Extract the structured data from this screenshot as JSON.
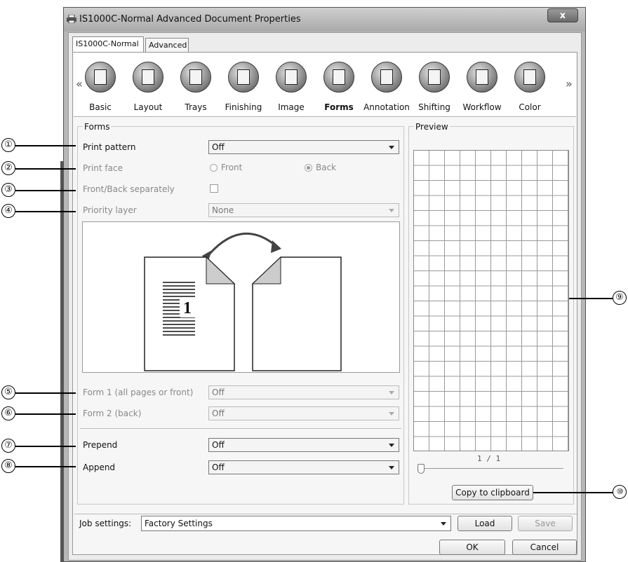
{
  "window": {
    "title": "IS1000C-Normal Advanced Document Properties",
    "close_label": "x"
  },
  "tabs": [
    {
      "label": "IS1000C-Normal"
    },
    {
      "label": "Advanced"
    }
  ],
  "iconbar": {
    "prev_arrow": "«",
    "next_arrow": "»",
    "items": [
      {
        "label": "Basic",
        "icon": "basic-icon"
      },
      {
        "label": "Layout",
        "icon": "layout-icon"
      },
      {
        "label": "Trays",
        "icon": "trays-icon"
      },
      {
        "label": "Finishing",
        "icon": "finishing-icon"
      },
      {
        "label": "Image",
        "icon": "image-icon"
      },
      {
        "label": "Forms",
        "icon": "forms-icon",
        "selected": true
      },
      {
        "label": "Annotation",
        "icon": "annotation-icon"
      },
      {
        "label": "Shifting",
        "icon": "shifting-icon"
      },
      {
        "label": "Workflow",
        "icon": "workflow-icon"
      },
      {
        "label": "Color",
        "icon": "color-icon"
      }
    ]
  },
  "forms": {
    "group_title": "Forms",
    "print_pattern": {
      "label": "Print pattern",
      "value": "Off"
    },
    "print_face": {
      "label": "Print face",
      "front": "Front",
      "back": "Back",
      "selected": "Back"
    },
    "front_back_sep": {
      "label": "Front/Back separately",
      "checked": false
    },
    "priority_layer": {
      "label": "Priority layer",
      "value": "None"
    },
    "illustration": {
      "page_number": "1"
    },
    "form1": {
      "label": "Form 1 (all pages or front)",
      "value": "Off"
    },
    "form2": {
      "label": "Form 2 (back)",
      "value": "Off"
    },
    "prepend": {
      "label": "Prepend",
      "value": "Off"
    },
    "append": {
      "label": "Append",
      "value": "Off"
    }
  },
  "preview": {
    "group_title": "Preview",
    "page_indicator": "1 / 1",
    "copy_label": "Copy to clipboard"
  },
  "job": {
    "label": "Job settings:",
    "value": "Factory Settings",
    "load_label": "Load",
    "save_label": "Save"
  },
  "footer": {
    "ok_label": "OK",
    "cancel_label": "Cancel"
  },
  "callouts": [
    "①",
    "②",
    "③",
    "④",
    "⑤",
    "⑥",
    "⑦",
    "⑧",
    "⑨",
    "⑩"
  ]
}
